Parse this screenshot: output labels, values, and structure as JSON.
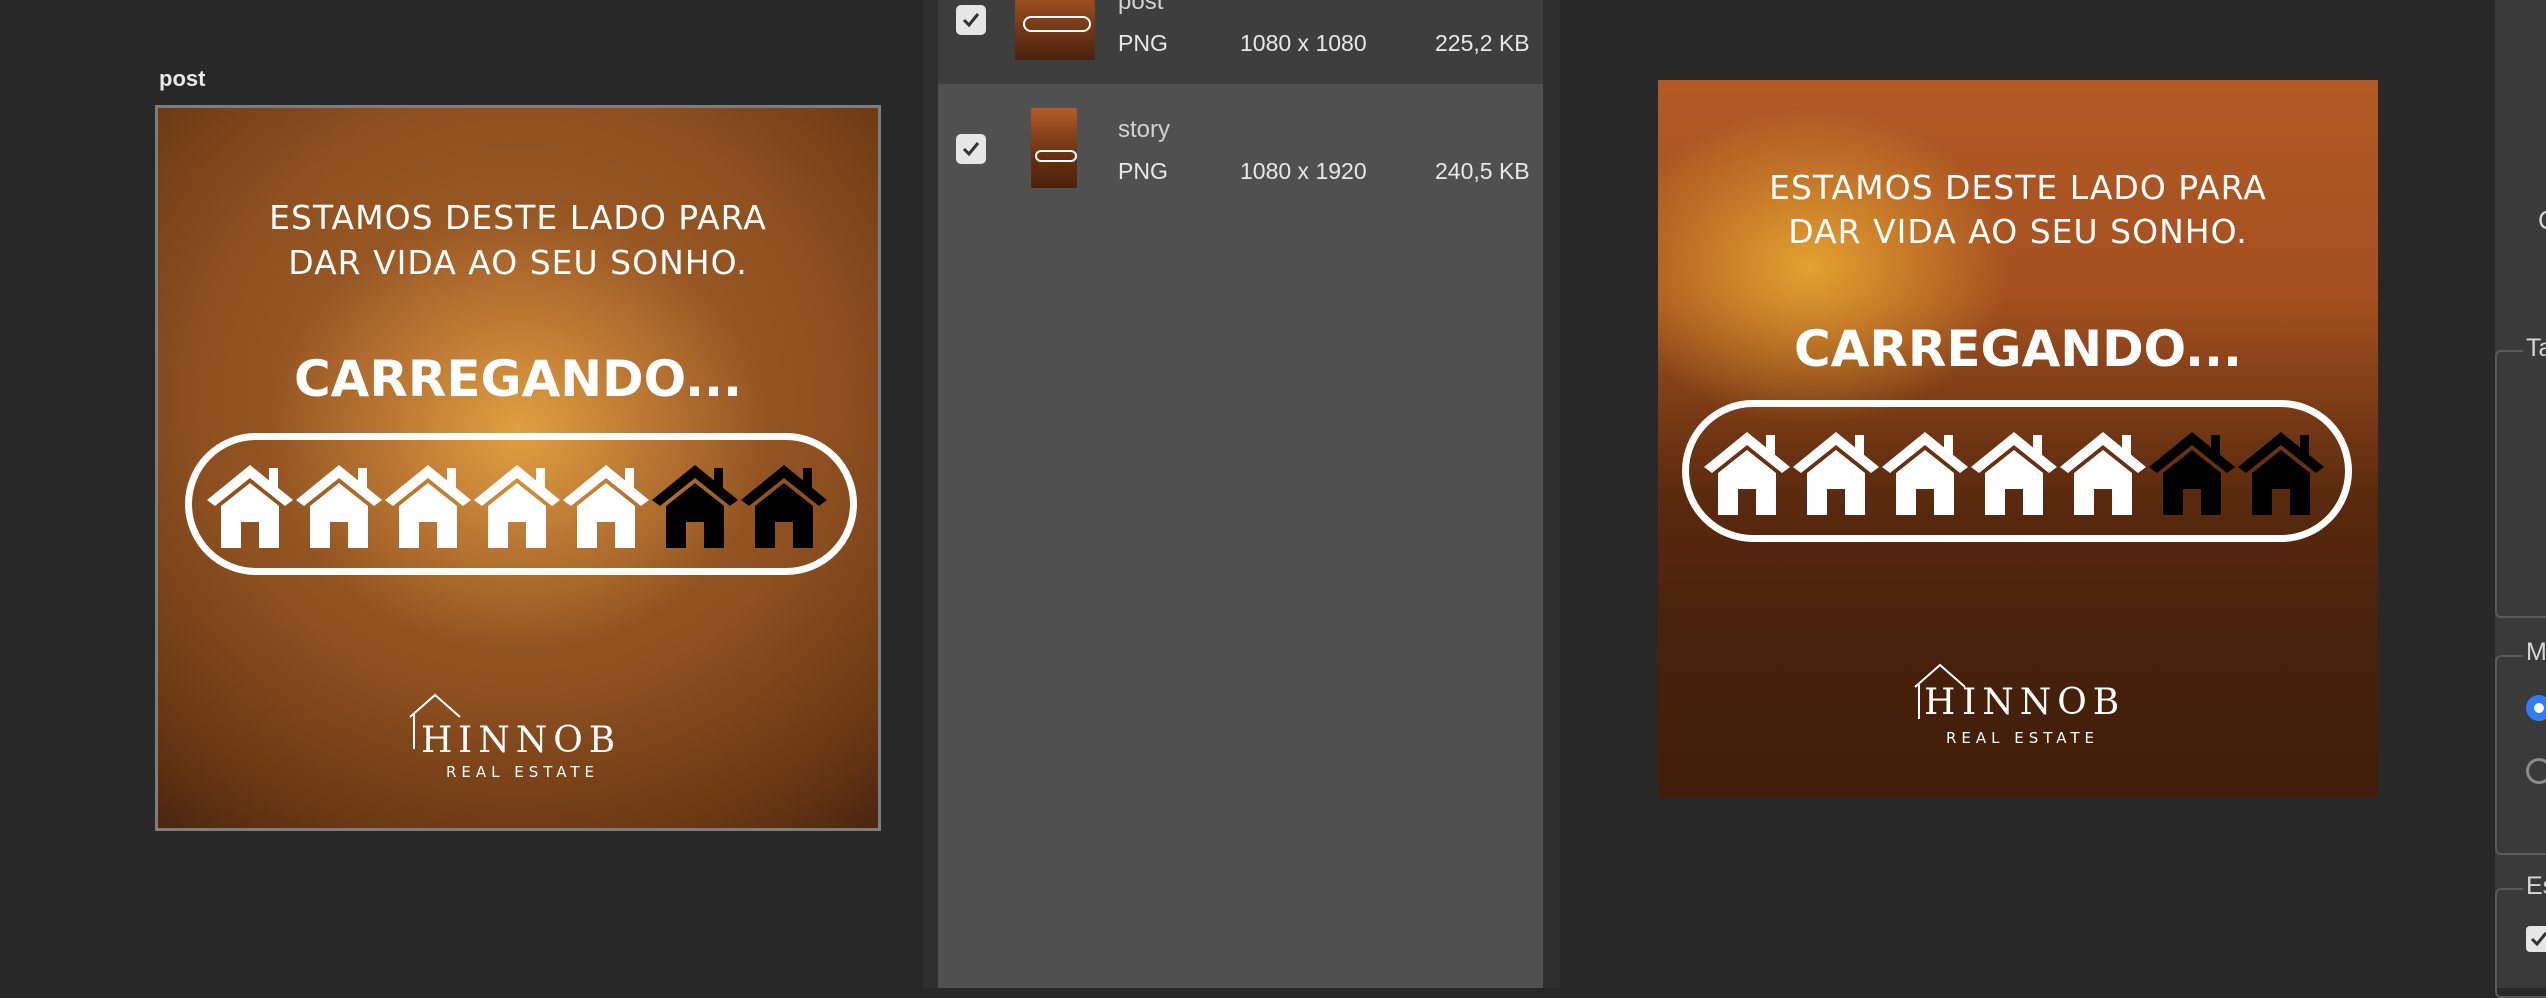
{
  "canvas": {
    "artboard_label": "post"
  },
  "artwork": {
    "headline_line1": "ESTAMOS DESTE LADO PARA",
    "headline_line2": "DAR VIDA AO SEU SONHO.",
    "loading_text": "CARREGANDO...",
    "progress": {
      "filled": 5,
      "total": 7
    },
    "logo_letter": "H",
    "logo_word": "INNOB",
    "logo_subtitle": "REAL ESTATE"
  },
  "file_list": [
    {
      "name": "post",
      "type": "PNG",
      "dimensions": "1080 x 1080",
      "size": "225,2 KB",
      "checked": true,
      "selected": true
    },
    {
      "name": "story",
      "type": "PNG",
      "dimensions": "1080 x 1920",
      "size": "240,5 KB",
      "checked": true,
      "selected": false
    }
  ],
  "settings": {
    "group1_label": "Ta",
    "group2_label": "M",
    "group3_label": "Es",
    "partial_letter": "C"
  },
  "colors": {
    "accent_blue": "#2d7ff9",
    "panel_gray": "#505050",
    "background": "#282828"
  },
  "icons": [
    "house-icon",
    "checkmark-icon",
    "logo-house-icon"
  ]
}
